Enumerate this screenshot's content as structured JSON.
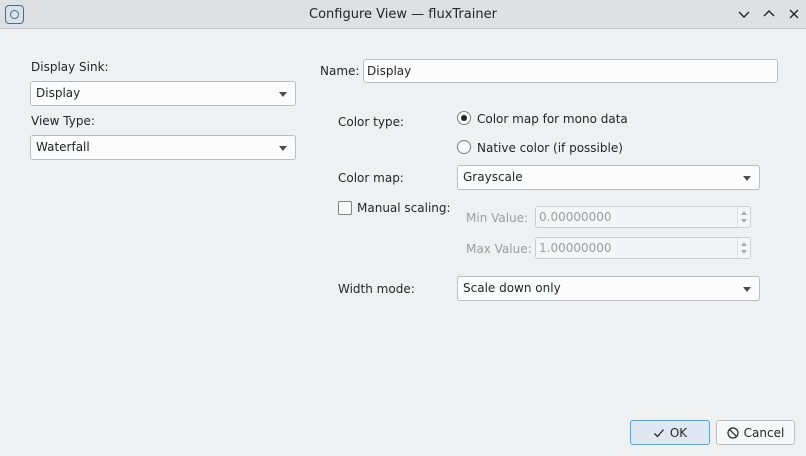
{
  "window": {
    "title": "Configure View — fluxTrainer"
  },
  "left": {
    "display_sink_label": "Display Sink:",
    "display_sink_value": "Display",
    "view_type_label": "View Type:",
    "view_type_value": "Waterfall"
  },
  "right": {
    "name_label": "Name:",
    "name_value": "Display",
    "color_type_label": "Color type:",
    "color_type_options": [
      "Color map for mono data",
      "Native color (if possible)"
    ],
    "color_type_selected": "Color map for mono data",
    "color_map_label": "Color map:",
    "color_map_value": "Grayscale",
    "manual_scaling_label": "Manual scaling:",
    "manual_scaling_checked": false,
    "min_value_label": "Min Value:",
    "min_value": "0.00000000",
    "max_value_label": "Max Value:",
    "max_value": "1.00000000",
    "width_mode_label": "Width mode:",
    "width_mode_value": "Scale down only"
  },
  "buttons": {
    "ok_label": "OK",
    "cancel_label": "Cancel"
  },
  "icons": {
    "app": "app-chip-icon",
    "minimize": "chevron-down-icon",
    "maximize": "chevron-up-icon",
    "close": "close-icon",
    "ok": "checkmark-icon",
    "cancel": "cancel-circle-icon"
  },
  "colors": {
    "accent": "#3daee9",
    "window_bg": "#eff0f1",
    "titlebar_bg": "#dee0e2"
  }
}
